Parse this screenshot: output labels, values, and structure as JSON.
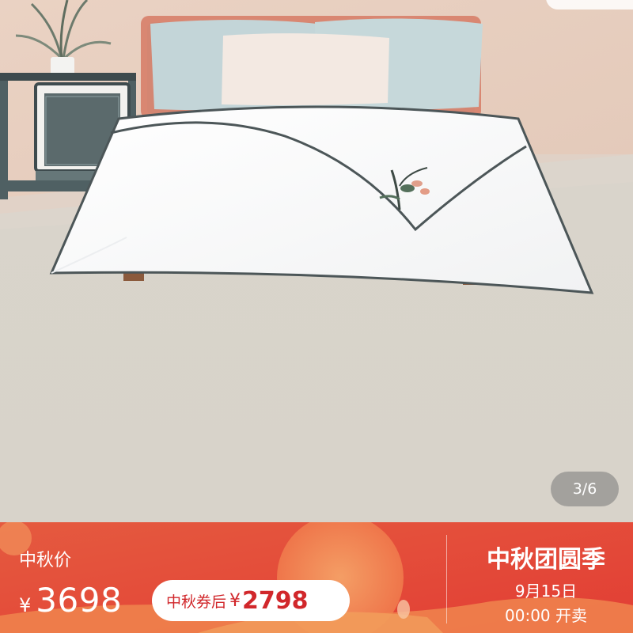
{
  "product_image": {
    "counter": "3/6",
    "description_icon": "bed-product-photo"
  },
  "promo_bar": {
    "price_label": "中秋价",
    "currency": "¥",
    "price": "3698",
    "coupon_label": "中秋券后",
    "coupon_currency": "¥",
    "coupon_price": "2798",
    "event_title": "中秋团圆季",
    "event_date": "9月15日",
    "event_time": "00:00 开卖"
  },
  "colors": {
    "promo_red": "#e4473a",
    "coupon_text": "#d1272b"
  }
}
